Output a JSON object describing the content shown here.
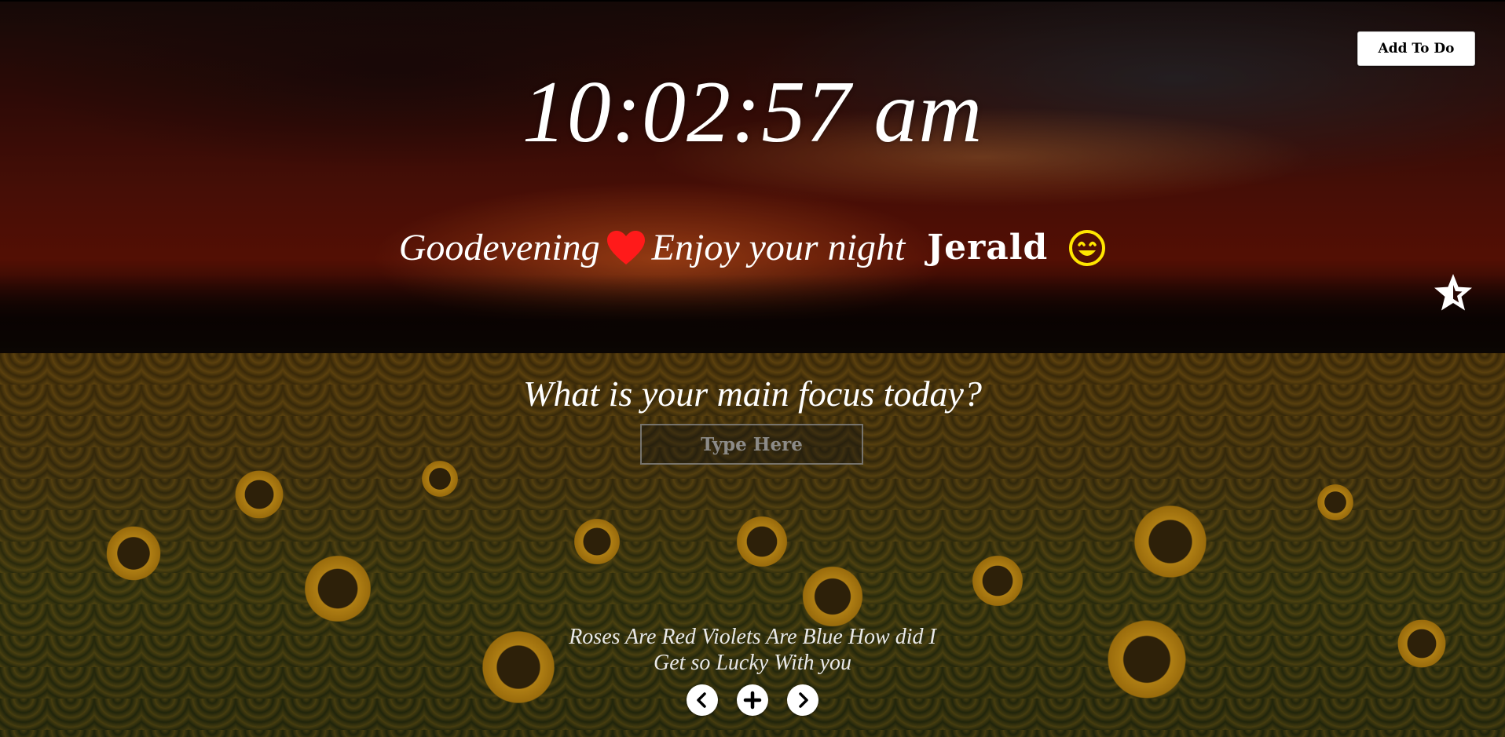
{
  "colors": {
    "heart": "#ff1a1a",
    "smiley": "#ffe600",
    "text": "#ffffff"
  },
  "toolbar": {
    "add_todo_label": "Add To Do"
  },
  "clock": {
    "time": "10:02:57 am"
  },
  "greeting": {
    "salutation": "Goodevening",
    "message": "Enjoy your night",
    "name": "Jerald",
    "heart_icon": "heart-icon",
    "smiley_icon": "smiley-icon"
  },
  "favorite": {
    "icon": "star-icon"
  },
  "focus": {
    "question": "What is your main focus today?",
    "placeholder": "Type Here",
    "value": ""
  },
  "quote": {
    "line1": "Roses Are Red Violets Are Blue How did I",
    "line2": "Get so Lucky With you"
  },
  "quote_controls": {
    "prev_icon": "chevron-left-icon",
    "add_icon": "plus-icon",
    "next_icon": "chevron-right-icon"
  }
}
